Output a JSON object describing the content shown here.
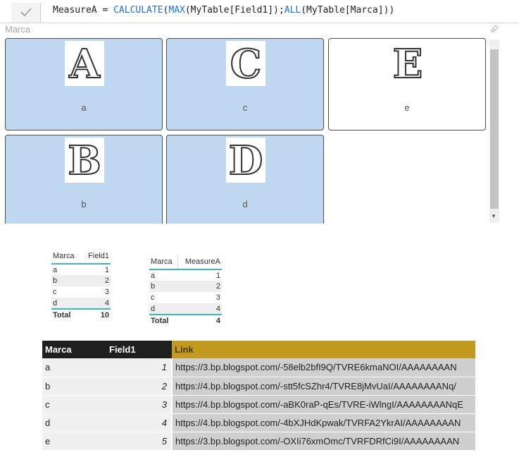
{
  "formula": {
    "measure_name": "MeasureA = ",
    "fn_calculate": "CALCULATE",
    "p1": "(",
    "fn_max": "MAX",
    "arg1": "(MyTable[Field1]);",
    "fn_all": "ALL",
    "arg2": "(MyTable[Marca]))"
  },
  "slicer": {
    "title": "Marca",
    "tiles": [
      {
        "letter": "A",
        "label": "a",
        "selected": true
      },
      {
        "letter": "C",
        "label": "c",
        "selected": true
      },
      {
        "letter": "E",
        "label": "e",
        "selected": false
      },
      {
        "letter": "B",
        "label": "b",
        "selected": true
      },
      {
        "letter": "D",
        "label": "d",
        "selected": true
      }
    ]
  },
  "table1": {
    "headers": [
      "Marca",
      "Field1"
    ],
    "rows": [
      [
        "a",
        "1"
      ],
      [
        "b",
        "2"
      ],
      [
        "c",
        "3"
      ],
      [
        "d",
        "4"
      ]
    ],
    "total": [
      "Total",
      "10"
    ]
  },
  "table2": {
    "headers": [
      "Marca",
      "MeasureA"
    ],
    "rows": [
      [
        "a",
        "1"
      ],
      [
        "b",
        "2"
      ],
      [
        "c",
        "3"
      ],
      [
        "d",
        "4"
      ]
    ],
    "total": [
      "Total",
      "4"
    ]
  },
  "table3": {
    "headers": [
      "Marca",
      "Field1",
      "Link"
    ],
    "rows": [
      [
        "a",
        "1",
        "https://3.bp.blogspot.com/-58elb2bfI9Q/TVRE6kmaNOI/AAAAAAAAN"
      ],
      [
        "b",
        "2",
        "https://4.bp.blogspot.com/-stt5fcSZhr4/TVRE8jMvUaI/AAAAAAAANq/"
      ],
      [
        "c",
        "3",
        "https://4.bp.blogspot.com/-aBK0raP-qEs/TVRE-iWlngI/AAAAAAAANqE"
      ],
      [
        "d",
        "4",
        "https://4.bp.blogspot.com/-4bXJHdKpwak/TVRFA2YkrAI/AAAAAAAAN"
      ],
      [
        "e",
        "5",
        "https://3.bp.blogspot.com/-OXIi76xmOmc/TVRFDRfCi9I/AAAAAAAAN"
      ]
    ]
  },
  "colors": {
    "selected_tile": "#bfd8ef",
    "accent_teal": "#3cb8b8",
    "link_header": "#c19a1f"
  }
}
